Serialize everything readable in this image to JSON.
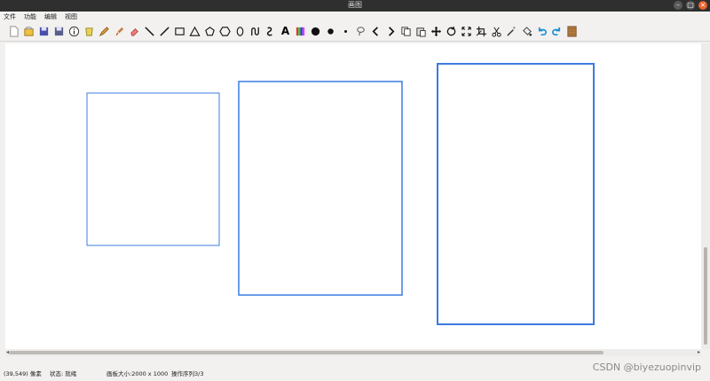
{
  "window": {
    "title": "画图"
  },
  "menu": {
    "items": [
      "文件",
      "功能",
      "编辑",
      "视图"
    ]
  },
  "toolbar": {
    "tools": [
      "new-file-icon",
      "open-file-icon",
      "save-icon",
      "save-as-icon",
      "info-icon",
      "clear-icon",
      "pen-icon",
      "brush-icon",
      "eraser-icon",
      "line-icon",
      "slash-line-icon",
      "rectangle-icon",
      "triangle-icon",
      "pentagon-icon",
      "hexagon-icon",
      "ellipse-icon",
      "curve-icon",
      "spline-icon",
      "text-icon",
      "color-palette-icon",
      "large-dot-icon",
      "medium-dot-icon",
      "small-dot-icon",
      "lasso-icon",
      "undo-arrow-icon",
      "redo-arrow-icon",
      "copy-icon",
      "paste-icon",
      "move-icon",
      "rotate-icon",
      "scale-icon",
      "crop-icon",
      "cut-icon",
      "magic-wand-icon",
      "fill-icon",
      "undo-icon",
      "redo-icon",
      "wood-texture-icon"
    ],
    "text_glyph": "A"
  },
  "status": {
    "coords": "(39,549) 像素",
    "state": "状态: 就绪",
    "canvas_size": "画板大小:2000 x 1000",
    "sequence": "操作序列3/3"
  },
  "watermark": "CSDN @biyezuopinvip",
  "colors": {
    "rect_stroke": "#3c7be0"
  }
}
